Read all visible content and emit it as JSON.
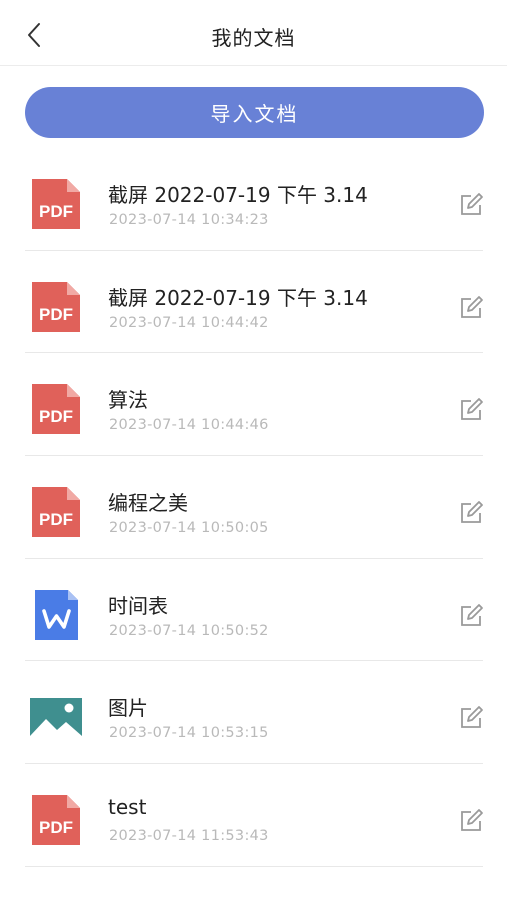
{
  "header": {
    "title": "我的文档"
  },
  "import_button": {
    "label": "导入文档"
  },
  "files": [
    {
      "name": "截屏 2022-07-19 下午 3.14",
      "time": "2023-07-14 10:34:23",
      "type": "pdf",
      "icon": "pdf-icon"
    },
    {
      "name": "截屏 2022-07-19 下午 3.14",
      "time": "2023-07-14 10:44:42",
      "type": "pdf",
      "icon": "pdf-icon"
    },
    {
      "name": "算法",
      "time": "2023-07-14 10:44:46",
      "type": "pdf",
      "icon": "pdf-icon"
    },
    {
      "name": "编程之美",
      "time": "2023-07-14 10:50:05",
      "type": "pdf",
      "icon": "pdf-icon"
    },
    {
      "name": "时间表",
      "time": "2023-07-14 10:50:52",
      "type": "word",
      "icon": "word-icon"
    },
    {
      "name": "图片",
      "time": "2023-07-14 10:53:15",
      "type": "image",
      "icon": "image-icon"
    },
    {
      "name": "test",
      "time": "2023-07-14 11:53:43",
      "type": "pdf",
      "icon": "pdf-icon"
    }
  ],
  "colors": {
    "accent": "#6881d6",
    "pdf": "#e0615a",
    "word": "#4a7ce6",
    "image": "#3f8f8f",
    "secondary_text": "#b9b9b9"
  }
}
